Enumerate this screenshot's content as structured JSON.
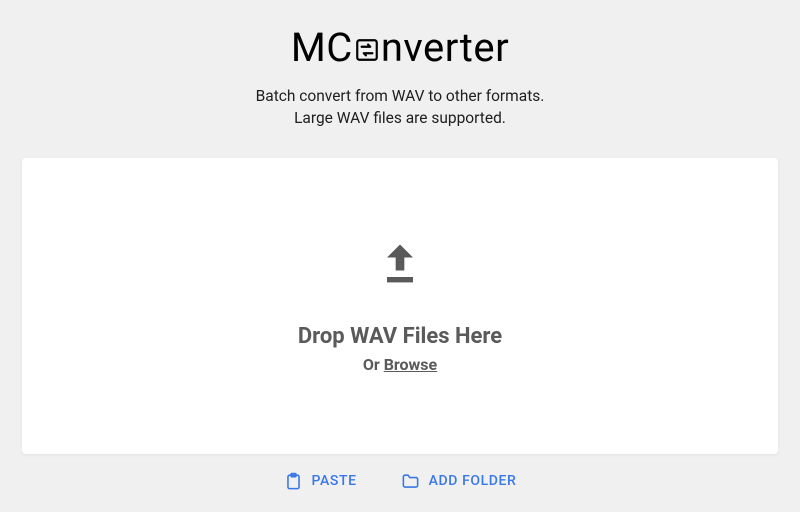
{
  "logo": {
    "prefix": "MC",
    "suffix": "nverter"
  },
  "subtitle": {
    "line1": "Batch convert from WAV to other formats.",
    "line2": "Large WAV files are supported."
  },
  "dropzone": {
    "title": "Drop WAV Files Here",
    "or": "Or ",
    "browse": "Browse"
  },
  "actions": {
    "paste": "PASTE",
    "addFolder": "ADD FOLDER"
  },
  "colors": {
    "accent": "#3b78e7",
    "muted": "#5a5a5a"
  }
}
